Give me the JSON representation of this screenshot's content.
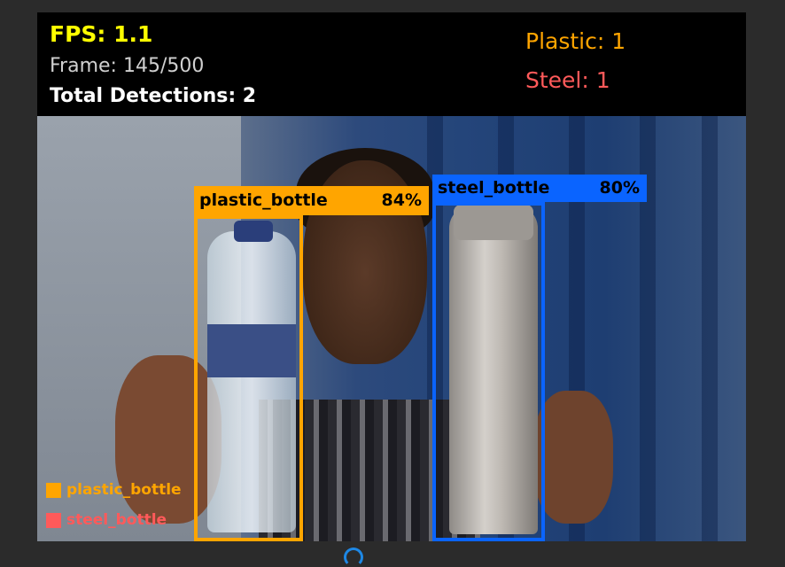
{
  "hud": {
    "fps": "FPS: 1.1",
    "frame": "Frame: 145/500",
    "total": "Total Detections: 2",
    "plastic_count": "Plastic: 1",
    "steel_count": "Steel: 1"
  },
  "detections": [
    {
      "label": "plastic_bottle",
      "confidence": "84%",
      "color": "#ffa500"
    },
    {
      "label": "steel_bottle",
      "confidence": "80%",
      "color": "#0a64ff"
    }
  ],
  "legend": [
    {
      "label": "plastic_bottle",
      "color": "#ffa500"
    },
    {
      "label": "steel_bottle",
      "color": "#ff5a5a"
    }
  ],
  "colors": {
    "fps": "#ffff00",
    "plastic": "#ffa500",
    "steel": "#ff5a5a",
    "steel_box": "#0a64ff",
    "loading": "#1e88e5"
  },
  "icons": {
    "loading": "loading-spinner-icon"
  }
}
